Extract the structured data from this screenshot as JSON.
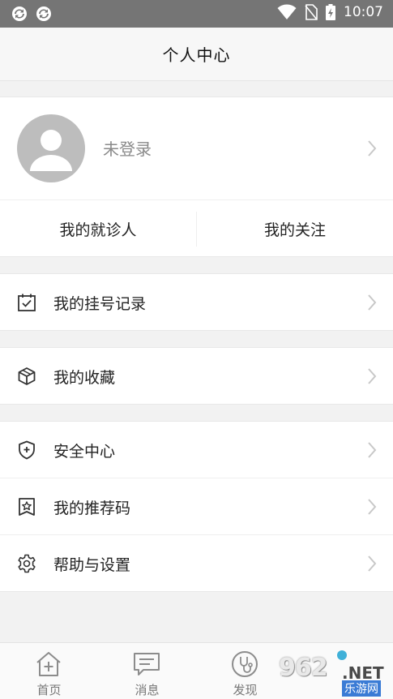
{
  "status_bar": {
    "time": "10:07",
    "left_icons": [
      "sync-icon",
      "sync-icon"
    ],
    "right_icons": [
      "wifi-icon",
      "no-sim-icon",
      "battery-charging-icon"
    ]
  },
  "header": {
    "title": "个人中心"
  },
  "profile": {
    "login_text": "未登录",
    "avatar_icon": "person-icon",
    "tabs": [
      {
        "label": "我的就诊人"
      },
      {
        "label": "我的关注"
      }
    ]
  },
  "menu": {
    "group1": [
      {
        "label": "我的挂号记录",
        "icon": "calendar-check-icon"
      }
    ],
    "group2": [
      {
        "label": "我的收藏",
        "icon": "box-icon"
      }
    ],
    "group3": [
      {
        "label": "安全中心",
        "icon": "shield-plus-icon"
      },
      {
        "label": "我的推荐码",
        "icon": "star-badge-icon"
      },
      {
        "label": "帮助与设置",
        "icon": "gear-icon"
      }
    ]
  },
  "tab_bar": {
    "items": [
      {
        "label": "首页",
        "icon": "home-icon"
      },
      {
        "label": "消息",
        "icon": "message-icon"
      },
      {
        "label": "发现",
        "icon": "stethoscope-icon"
      },
      {
        "label": "",
        "icon": ""
      }
    ]
  },
  "watermark": {
    "brand": "962",
    "net": ".NET",
    "sub": "乐游网"
  },
  "colors": {
    "status_bar": "#757575",
    "background": "#f2f2f2",
    "card": "#ffffff",
    "avatar": "#bdbdbd",
    "chevron": "#cccccc"
  }
}
